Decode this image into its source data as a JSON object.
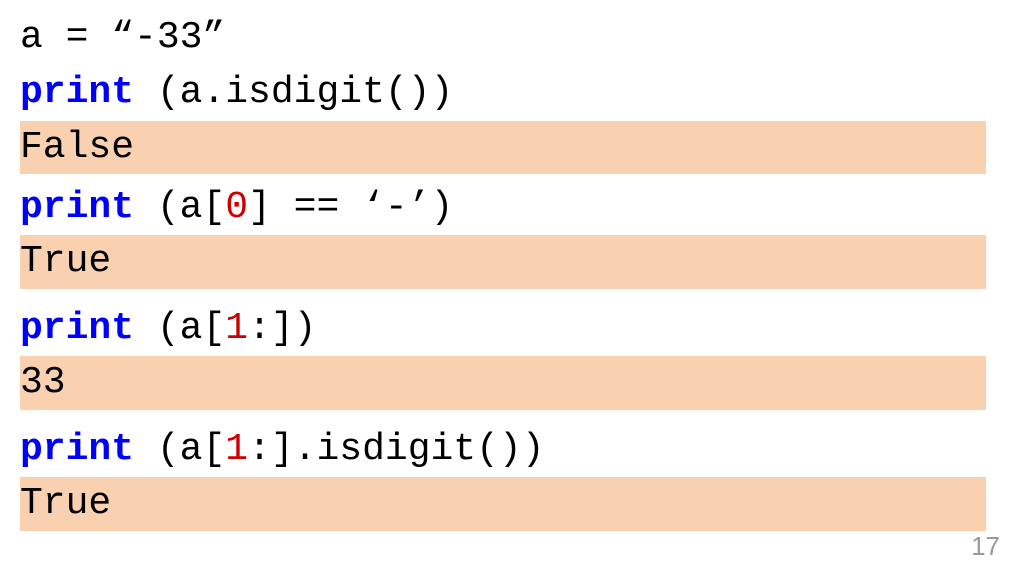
{
  "lines": {
    "l1": {
      "assignment": "a = ",
      "value": "“-33”"
    },
    "l2": {
      "kw": "print",
      "rest": " (a.isdigit())"
    },
    "out1": "False",
    "l3": {
      "kw": "print",
      "p1": " (a[",
      "idx": "0",
      "p2": "] == ",
      "str": "‘-’",
      "p3": ")"
    },
    "out2": "True",
    "l4": {
      "kw": "print",
      "p1": " (a[",
      "idx": "1",
      "p2": ":])"
    },
    "out3": "33",
    "l5": {
      "kw": "print",
      "p1": " (a[",
      "idx": "1",
      "p2": ":].isdigit())"
    },
    "out4": "True"
  },
  "page_number": "17"
}
